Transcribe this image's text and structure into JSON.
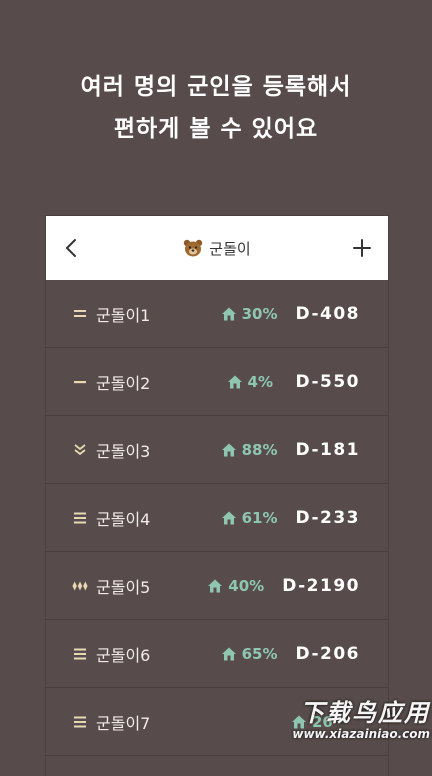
{
  "headline": {
    "line1": "여러 명의 군인을 등록해서",
    "line2": "편하게 볼 수 있어요"
  },
  "appbar": {
    "title": "군돌이",
    "back_icon": "chevron-left-icon",
    "add_icon": "plus-icon",
    "title_icon": "bear-face-icon"
  },
  "colors": {
    "background": "#574c4b",
    "accent_green": "#8ec6b2",
    "rank_gold": "#e8d7b3"
  },
  "soldiers": [
    {
      "name": "군돌이1",
      "rank_icon": "rank-two-bars-icon",
      "progress": "30%",
      "dday": "D-408"
    },
    {
      "name": "군돌이2",
      "rank_icon": "rank-one-bar-icon",
      "progress": "4%",
      "dday": "D-550"
    },
    {
      "name": "군돌이3",
      "rank_icon": "rank-chevron-icon",
      "progress": "88%",
      "dday": "D-181"
    },
    {
      "name": "군돌이4",
      "rank_icon": "rank-three-bars-icon",
      "progress": "61%",
      "dday": "D-233"
    },
    {
      "name": "군돌이5",
      "rank_icon": "rank-diamonds-icon",
      "progress": "40%",
      "dday": "D-2190"
    },
    {
      "name": "군돌이6",
      "rank_icon": "rank-three-bars-icon",
      "progress": "65%",
      "dday": "D-206"
    },
    {
      "name": "군돌이7",
      "rank_icon": "rank-three-bars-icon",
      "progress": "26",
      "dday": ""
    }
  ],
  "watermark": {
    "line1": "下载鸟应用",
    "line2": "www.xiazainiao.com"
  }
}
